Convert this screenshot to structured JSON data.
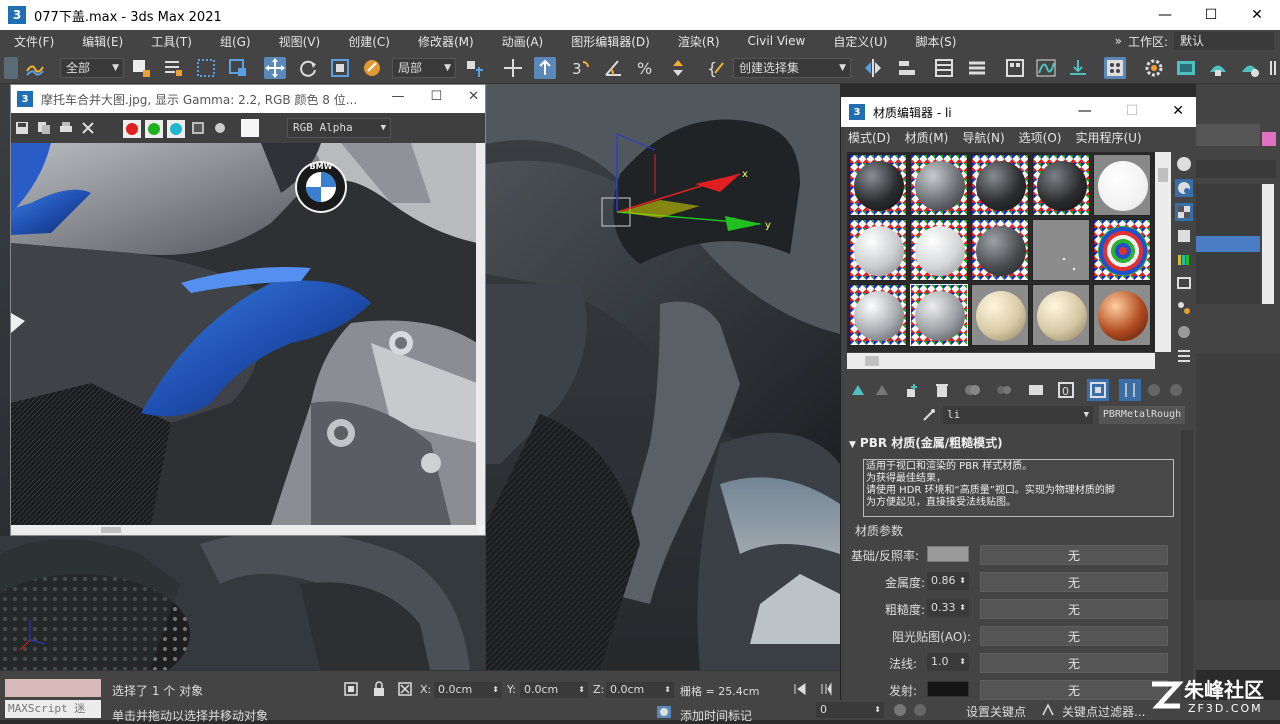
{
  "window": {
    "title": "077下盖.max - 3ds Max 2021",
    "logo": "3",
    "min": "—",
    "max": "☐",
    "close": "✕"
  },
  "menu": {
    "items": [
      "文件(F)",
      "编辑(E)",
      "工具(T)",
      "组(G)",
      "视图(V)",
      "创建(C)",
      "修改器(M)",
      "动画(A)",
      "图形编辑器(D)",
      "渲染(R)",
      "Civil View",
      "自定义(U)",
      "脚本(S)"
    ],
    "more": "»",
    "workspace_label": "工作区:",
    "workspace_value": "默认"
  },
  "toolbar": {
    "filter_value": "全部",
    "coord_value": "局部",
    "selection_set_placeholder": "创建选择集"
  },
  "image_viewer": {
    "logo": "3",
    "title": "摩托车合并大图.jpg, 显示 Gamma: 2.2, RGB 颜色 8 位...",
    "min": "—",
    "max": "☐",
    "close": "✕",
    "channel_value": "RGB Alpha",
    "logo_text": "BMW"
  },
  "material_editor": {
    "logo": "3",
    "title": "材质编辑器 - li",
    "min": "—",
    "max": "☐",
    "close": "✕",
    "menu": [
      "模式(D)",
      "材质(M)",
      "导航(N)",
      "选项(O)",
      "实用程序(U)"
    ],
    "material_name": "li",
    "material_type": "PBRMetalRough",
    "rollout_title": "PBR 材质(金属/粗糙模式)",
    "description": [
      "适用于视口和渲染的 PBR 样式材质。",
      "为获得最佳结果，",
      "请使用 HDR 环境和“高质量”视口。实现为物理材质的脚",
      "为方便起见，直接接受法线贴图。"
    ],
    "params_title": "材质参数",
    "params": [
      {
        "label": "基础/反照率:",
        "value": "",
        "map": "无"
      },
      {
        "label": "金属度:",
        "value": "0.86",
        "map": "无"
      },
      {
        "label": "粗糙度:",
        "value": "0.33",
        "map": "无"
      },
      {
        "label": "阻光贴图(AO):",
        "value": "",
        "map": "无"
      },
      {
        "label": "法线:",
        "value": "1.0",
        "map": "无"
      },
      {
        "label": "发射:",
        "value": "",
        "map": "无"
      }
    ]
  },
  "viewport": {
    "axis_x": "x",
    "axis_y": "y"
  },
  "status": {
    "maxscript": "MAXScript 迷",
    "selected": "选择了 1 个 对象",
    "hint": "单击并拖动以选择并移动对象",
    "x_label": "X:",
    "x_value": "0.0cm",
    "y_label": "Y:",
    "y_value": "0.0cm",
    "z_label": "Z:",
    "z_value": "0.0cm",
    "grid": "栅格 = 25.4cm",
    "add_time_tag": "添加时间标记",
    "frame_value": "0",
    "set_key": "设置关键点",
    "key_filter": "关键点过滤器..."
  },
  "watermark": {
    "brand": "朱峰社区",
    "url": "ZF3D.COM"
  },
  "colors": {
    "accent": "#2a7ad6",
    "slot_border": "#ffffff",
    "bmw_blue": "#1f5bb8"
  }
}
